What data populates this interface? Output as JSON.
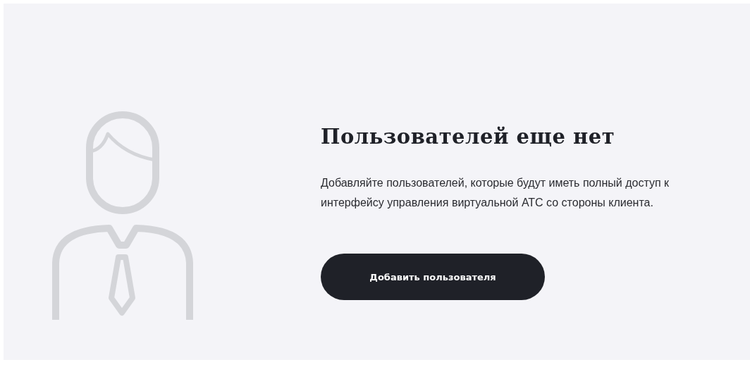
{
  "empty_state": {
    "title": "Пользователей еще нет",
    "description": "Добавляйте пользователей, которые будут иметь полный доступ к интерфейсу управления виртуальной АТС со стороны клиента.",
    "button": {
      "label": "Добавить пользователя"
    }
  }
}
